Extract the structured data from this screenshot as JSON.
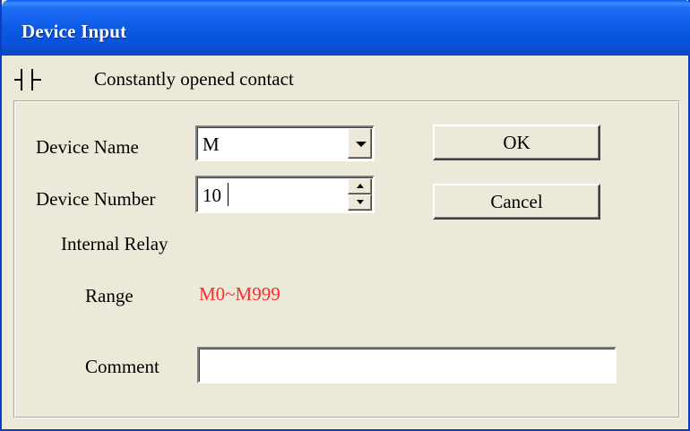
{
  "window": {
    "title": "Device Input"
  },
  "contact": {
    "icon": "normally-open-contact-icon",
    "label": "Constantly opened contact"
  },
  "form": {
    "device_name_label": "Device Name",
    "device_name_value": "M",
    "device_number_label": "Device Number",
    "device_number_value": "10",
    "device_type": "Internal Relay",
    "range_label": "Range",
    "range_value": "M0~M999",
    "comment_label": "Comment",
    "comment_value": ""
  },
  "buttons": {
    "ok": "OK",
    "cancel": "Cancel"
  },
  "colors": {
    "title_bar": "#0a5cf0",
    "range_text": "#ff2a2a",
    "dialog_bg": "#ece9d8"
  }
}
